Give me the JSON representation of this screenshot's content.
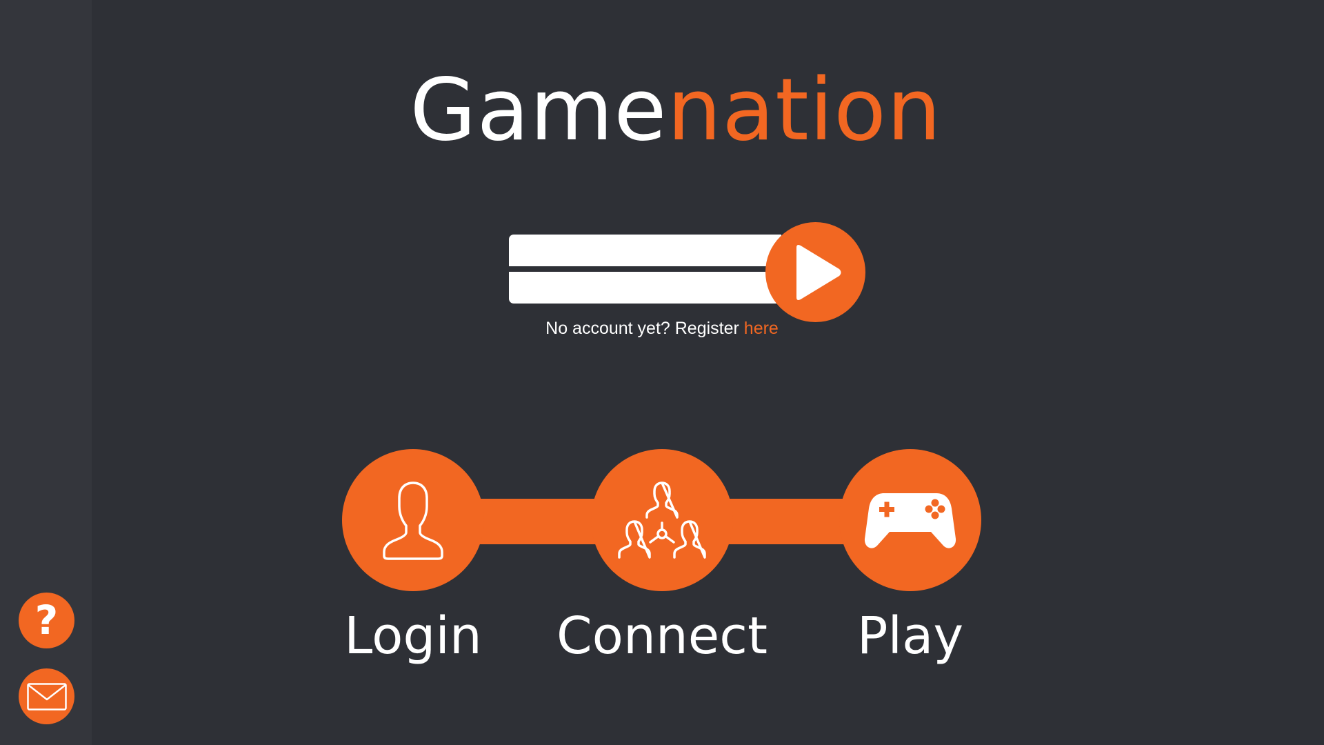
{
  "brand": {
    "part1": "Game",
    "part2": "nation"
  },
  "login_form": {
    "username_value": "",
    "password_value": "",
    "submit_icon": "play-triangle-icon"
  },
  "register": {
    "prompt": "No account yet? Register ",
    "link": "here"
  },
  "steps": [
    {
      "label": "Login",
      "icon": "user-icon"
    },
    {
      "label": "Connect",
      "icon": "network-people-icon"
    },
    {
      "label": "Play",
      "icon": "gamepad-icon"
    }
  ],
  "sidebar": {
    "help_glyph": "?",
    "help_icon": "question-mark-icon",
    "mail_icon": "envelope-icon"
  },
  "colors": {
    "background": "#2e3036",
    "sidebar": "#34363c",
    "accent": "#f26722",
    "text": "#ffffff"
  }
}
